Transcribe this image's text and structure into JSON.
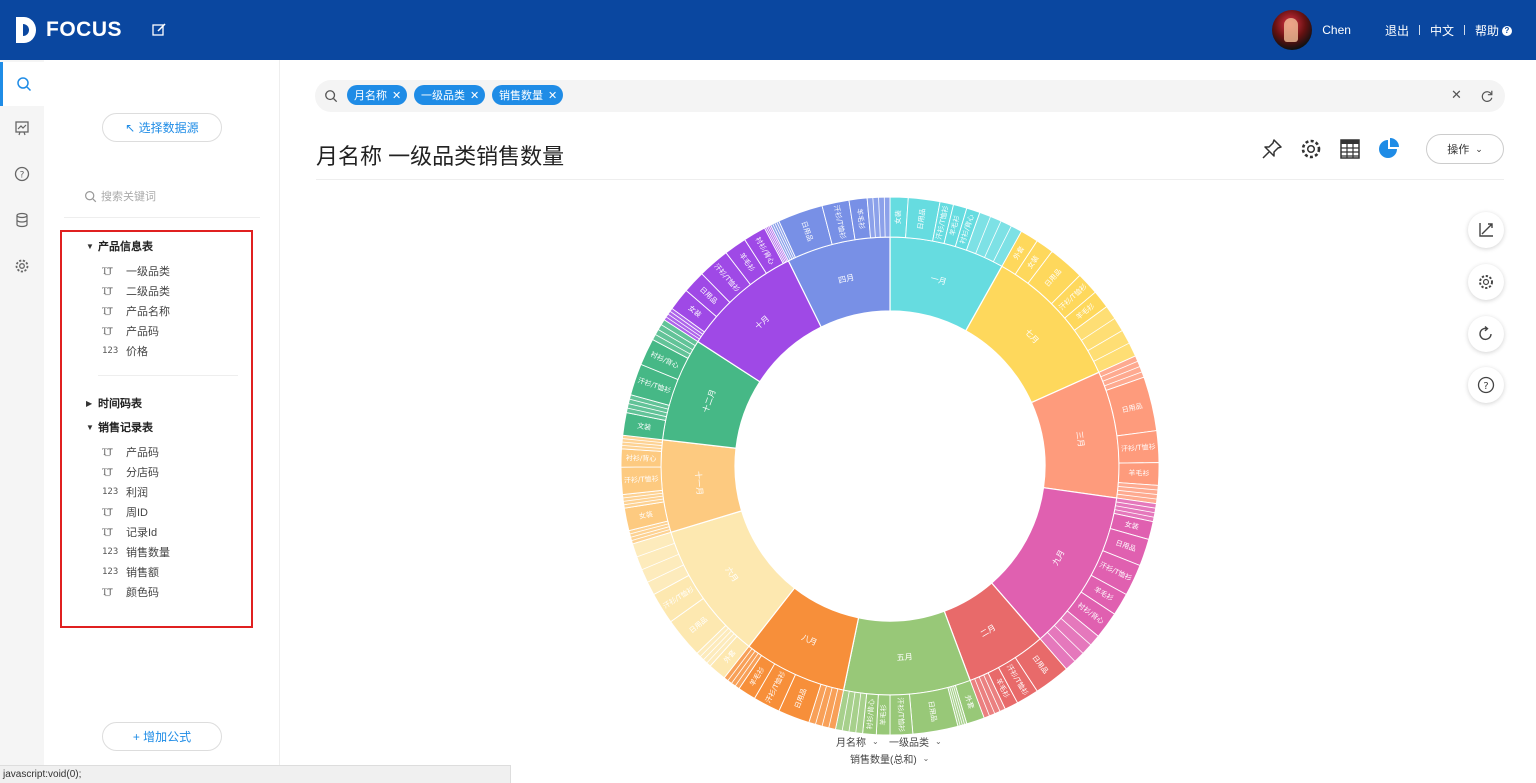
{
  "app": {
    "logo_text": "FOCUS"
  },
  "header": {
    "username": "Chen",
    "logout": "退出",
    "language": "中文",
    "help": "帮助"
  },
  "panel": {
    "select_source": "↖ 选择数据源",
    "search_placeholder": "搜索关键词",
    "tables": [
      {
        "name": "产品信息表",
        "expanded": true,
        "fields": [
          {
            "type": "text",
            "name": "一级品类"
          },
          {
            "type": "text",
            "name": "二级品类"
          },
          {
            "type": "text",
            "name": "产品名称"
          },
          {
            "type": "text",
            "name": "产品码"
          },
          {
            "type": "number",
            "name": "价格"
          }
        ]
      },
      {
        "name": "时间码表",
        "expanded": false,
        "fields": []
      },
      {
        "name": "销售记录表",
        "expanded": true,
        "fields": [
          {
            "type": "text",
            "name": "产品码"
          },
          {
            "type": "text",
            "name": "分店码"
          },
          {
            "type": "number",
            "name": "利润"
          },
          {
            "type": "text",
            "name": "周ID"
          },
          {
            "type": "text",
            "name": "记录Id"
          },
          {
            "type": "number",
            "name": "销售数量"
          },
          {
            "type": "number",
            "name": "销售额"
          },
          {
            "type": "text",
            "name": "颜色码"
          }
        ]
      }
    ],
    "add_formula": "+ 增加公式"
  },
  "search": {
    "chips": [
      "月名称",
      "一级品类",
      "销售数量"
    ]
  },
  "main": {
    "title": "月名称 一级品类销售数量",
    "ops_label": "操作"
  },
  "status_bar": "javascript:void(0);",
  "legend": {
    "dim1": "月名称",
    "dim2": "一级品类",
    "measure": "销售数量(总和)"
  },
  "colors": {
    "brand": "#0a47a0",
    "accent": "#1f8ce6"
  },
  "chart_data": {
    "type": "sunburst",
    "levels": [
      "月名称",
      "一级品类"
    ],
    "measure": "销售数量(总和)",
    "months": [
      {
        "name": "一月",
        "value": 60,
        "color": "#66dce0",
        "children": [
          {
            "name": "女装",
            "value": 8
          },
          {
            "name": "日用品",
            "value": 14
          },
          {
            "name": "汗衫/T恤衫",
            "value": 6
          },
          {
            "name": "羊毛衫",
            "value": 6
          },
          {
            "name": "衬衫/背心",
            "value": 6
          },
          {
            "name": "",
            "value": 20
          }
        ]
      },
      {
        "name": "七月",
        "value": 75,
        "color": "#fed85c",
        "children": [
          {
            "name": "外套",
            "value": 8
          },
          {
            "name": "女装",
            "value": 8
          },
          {
            "name": "日用品",
            "value": 16
          },
          {
            "name": "汗衫/T恤衫",
            "value": 10
          },
          {
            "name": "羊毛衫",
            "value": 8
          },
          {
            "name": "",
            "value": 25
          }
        ]
      },
      {
        "name": "三月",
        "value": 66,
        "color": "#fe9b7c",
        "children": [
          {
            "name": "",
            "value": 10
          },
          {
            "name": "日用品",
            "value": 24
          },
          {
            "name": "汗衫/T恤衫",
            "value": 14
          },
          {
            "name": "羊毛衫",
            "value": 10
          },
          {
            "name": "",
            "value": 8
          }
        ]
      },
      {
        "name": "九月",
        "value": 84,
        "color": "#e060b0",
        "children": [
          {
            "name": "",
            "value": 8
          },
          {
            "name": "女装",
            "value": 8
          },
          {
            "name": "日用品",
            "value": 12
          },
          {
            "name": "汗衫/T恤衫",
            "value": 14
          },
          {
            "name": "羊毛衫",
            "value": 10
          },
          {
            "name": "衬衫/背心",
            "value": 12
          },
          {
            "name": "",
            "value": 20
          }
        ]
      },
      {
        "name": "二月",
        "value": 42,
        "color": "#e86a6a",
        "children": [
          {
            "name": "日用品",
            "value": 16
          },
          {
            "name": "汗衫/T恤衫",
            "value": 10
          },
          {
            "name": "羊毛衫",
            "value": 6
          },
          {
            "name": "",
            "value": 10
          }
        ]
      },
      {
        "name": "五月",
        "value": 66,
        "color": "#98c878",
        "children": [
          {
            "name": "外套",
            "value": 8
          },
          {
            "name": "",
            "value": 4
          },
          {
            "name": "日用品",
            "value": 20
          },
          {
            "name": "汗衫/T恤衫",
            "value": 10
          },
          {
            "name": "羊毛衫",
            "value": 6
          },
          {
            "name": "衬衫/背心",
            "value": 6
          },
          {
            "name": "",
            "value": 12
          }
        ]
      },
      {
        "name": "八月",
        "value": 54,
        "color": "#f78f3a",
        "children": [
          {
            "name": "",
            "value": 12
          },
          {
            "name": "日用品",
            "value": 14
          },
          {
            "name": "汗衫/T恤衫",
            "value": 12
          },
          {
            "name": "羊毛衫",
            "value": 8
          },
          {
            "name": "",
            "value": 8
          }
        ]
      },
      {
        "name": "六月",
        "value": 72,
        "color": "#fde8b0",
        "children": [
          {
            "name": "外套",
            "value": 8
          },
          {
            "name": "",
            "value": 8
          },
          {
            "name": "日用品",
            "value": 18
          },
          {
            "name": "汗衫/T恤衫",
            "value": 14
          },
          {
            "name": "",
            "value": 24
          }
        ]
      },
      {
        "name": "十一月",
        "value": 48,
        "color": "#fdca80",
        "children": [
          {
            "name": "",
            "value": 6
          },
          {
            "name": "女装",
            "value": 10
          },
          {
            "name": "",
            "value": 6
          },
          {
            "name": "汗衫/T恤衫",
            "value": 12
          },
          {
            "name": "衬衫/背心",
            "value": 8
          },
          {
            "name": "",
            "value": 6
          }
        ]
      },
      {
        "name": "十二月",
        "value": 54,
        "color": "#46b886",
        "children": [
          {
            "name": "文装",
            "value": 10
          },
          {
            "name": "",
            "value": 8
          },
          {
            "name": "汗衫/T恤衫",
            "value": 14
          },
          {
            "name": "衬衫/背心",
            "value": 12
          },
          {
            "name": "",
            "value": 10
          }
        ]
      },
      {
        "name": "十月",
        "value": 63,
        "color": "#9f49e6",
        "children": [
          {
            "name": "",
            "value": 6
          },
          {
            "name": "女装",
            "value": 10
          },
          {
            "name": "日用品",
            "value": 10
          },
          {
            "name": "汗衫/T恤衫",
            "value": 14
          },
          {
            "name": "羊毛衫",
            "value": 10
          },
          {
            "name": "衬衫/背心",
            "value": 10
          },
          {
            "name": "",
            "value": 3
          }
        ]
      },
      {
        "name": "四月",
        "value": 54,
        "color": "#7890e6",
        "children": [
          {
            "name": "",
            "value": 4
          },
          {
            "name": "日用品",
            "value": 20
          },
          {
            "name": "汗衫/T恤衫",
            "value": 12
          },
          {
            "name": "羊毛衫",
            "value": 8
          },
          {
            "name": "",
            "value": 10
          }
        ]
      }
    ]
  }
}
